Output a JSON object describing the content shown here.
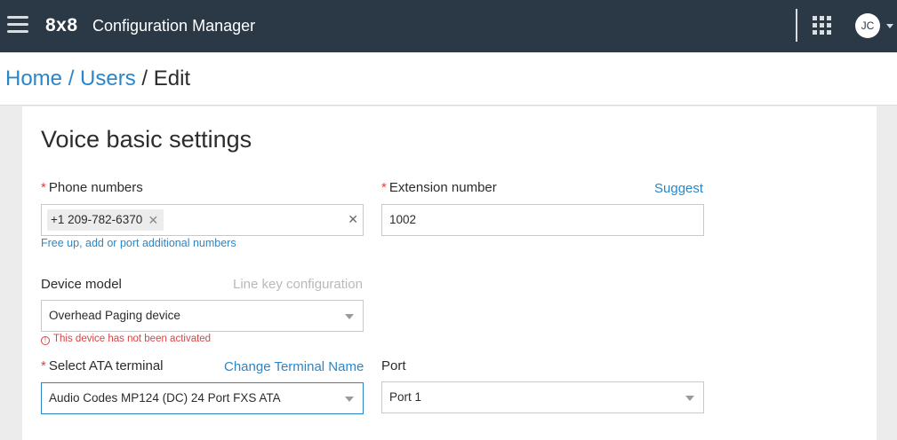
{
  "header": {
    "logo": "8x8",
    "app_title": "Configuration Manager",
    "avatar_initials": "JC"
  },
  "breadcrumb": {
    "home": "Home",
    "sep1": " / ",
    "users": "Users",
    "sep2": " / ",
    "current": "Edit"
  },
  "form": {
    "title": "Voice basic settings",
    "phone_numbers": {
      "required_mark": "*",
      "label": "Phone numbers",
      "tags": [
        "+1 209-782-6370"
      ],
      "helper_link": "Free up, add or port additional numbers"
    },
    "extension": {
      "required_mark": "*",
      "label": "Extension number",
      "suggest_link": "Suggest",
      "value": "1002"
    },
    "device_model": {
      "label": "Device model",
      "line_key_link": "Line key configuration",
      "value": "Overhead Paging device",
      "error": "This device has not been activated"
    },
    "ata_terminal": {
      "required_mark": "*",
      "label": "Select ATA terminal",
      "change_link": "Change Terminal Name",
      "value": "Audio Codes MP124 (DC) 24 Port FXS ATA"
    },
    "port": {
      "label": "Port",
      "value": "Port 1"
    }
  },
  "colors": {
    "topbar": "#2b3845",
    "link": "#2a86c8",
    "error": "#d64545"
  }
}
